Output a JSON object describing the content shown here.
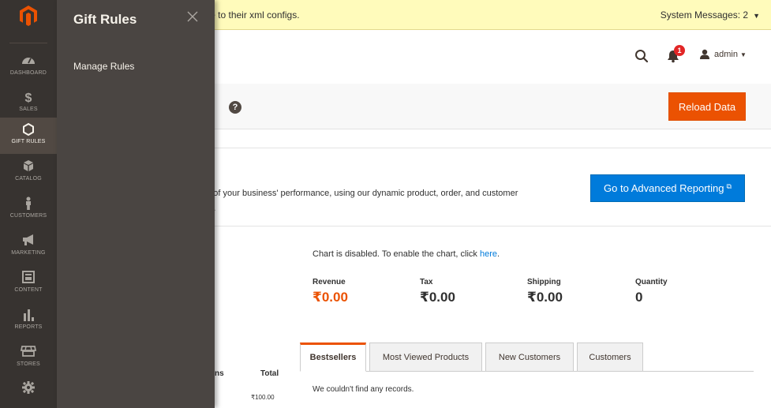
{
  "notice": {
    "message": "have been reset because of a change to their xml configs.",
    "system_messages": "System Messages: 2"
  },
  "header": {
    "notification_count": "1",
    "user": "admin",
    "icons": [
      "search-icon",
      "bell-icon",
      "user-icon"
    ]
  },
  "page_actions": {
    "help": "?",
    "reload_label": "Reload Data"
  },
  "advanced_reporting": {
    "text_line1": "nd of your business' performance, using our dynamic product, order, and customer",
    "text_line2": "ata.",
    "button_label": "Go to Advanced Reporting"
  },
  "chart": {
    "message": "Chart is disabled. To enable the chart, click ",
    "link": "here",
    "period": "."
  },
  "totals": [
    {
      "label": "Revenue",
      "value": "₹0.00"
    },
    {
      "label": "Tax",
      "value": "₹0.00"
    },
    {
      "label": "Shipping",
      "value": "₹0.00"
    },
    {
      "label": "Quantity",
      "value": "0"
    }
  ],
  "grid": {
    "col_fragment": "ns",
    "col_total": "Total",
    "cell_fragment": "₹100.00"
  },
  "tabs": [
    {
      "label": "Bestsellers",
      "active": true
    },
    {
      "label": "Most Viewed Products",
      "active": false
    },
    {
      "label": "New Customers",
      "active": false
    },
    {
      "label": "Customers",
      "active": false
    }
  ],
  "no_records": "We couldn't find any records.",
  "nav": {
    "items": [
      {
        "label": "DASHBOARD",
        "icon": "dashboard-icon"
      },
      {
        "label": "SALES",
        "icon": "dollar-icon"
      },
      {
        "label": "GIFT RULES",
        "icon": "hexagon-icon",
        "active": true
      },
      {
        "label": "CATALOG",
        "icon": "cube-icon"
      },
      {
        "label": "CUSTOMERS",
        "icon": "person-icon"
      },
      {
        "label": "MARKETING",
        "icon": "megaphone-icon"
      },
      {
        "label": "CONTENT",
        "icon": "layout-icon"
      },
      {
        "label": "REPORTS",
        "icon": "bar-chart-icon"
      },
      {
        "label": "STORES",
        "icon": "store-icon"
      },
      {
        "label": "",
        "icon": "gear-icon"
      }
    ]
  },
  "flyout": {
    "title": "Gift Rules",
    "link": "Manage Rules"
  },
  "colors": {
    "accent": "#eb5202",
    "primary": "#007bdb",
    "nav_bg": "#373330",
    "flyout_bg": "#4a4542",
    "notice_bg": "#fffbbb"
  }
}
